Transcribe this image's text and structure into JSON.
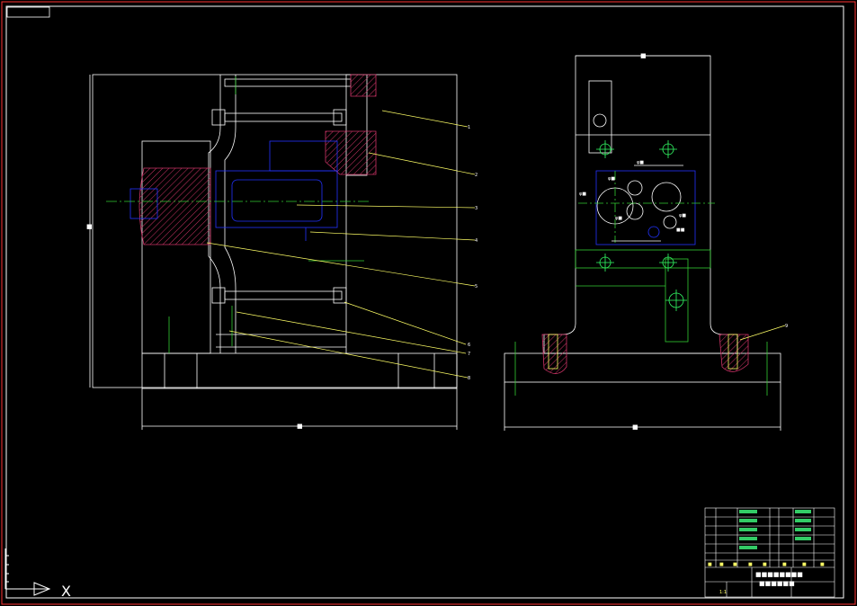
{
  "drawing": {
    "background": "#000000",
    "colors": {
      "frame": "#ff3333",
      "outline": "#ffffff",
      "fixture": "#2233ff",
      "hatch": "#cc3366",
      "centerline": "#33cc33",
      "leader": "#ffff66",
      "bolt": "#33ff66"
    },
    "front_view": {
      "dimension_bottom": "■",
      "dimension_left": "■",
      "leader_numbers": [
        "1",
        "2",
        "3",
        "4",
        "5",
        "6",
        "7",
        "8"
      ]
    },
    "side_view": {
      "dimension_top": "■",
      "dimension_bottom": "■",
      "leader_number": "9",
      "hole_labels": [
        "φ■",
        "φ■",
        "φ■",
        "φ■",
        "φ■",
        "■■"
      ]
    },
    "title_block": {
      "title_line1": "■■■■■■■■",
      "title_line2": "■■■■■■",
      "header_cells": [
        "■",
        "■",
        "■",
        "■",
        "■",
        "■",
        "■",
        "■"
      ],
      "scale": "1:1"
    },
    "ucs_icon": {
      "x_label": "X"
    }
  }
}
